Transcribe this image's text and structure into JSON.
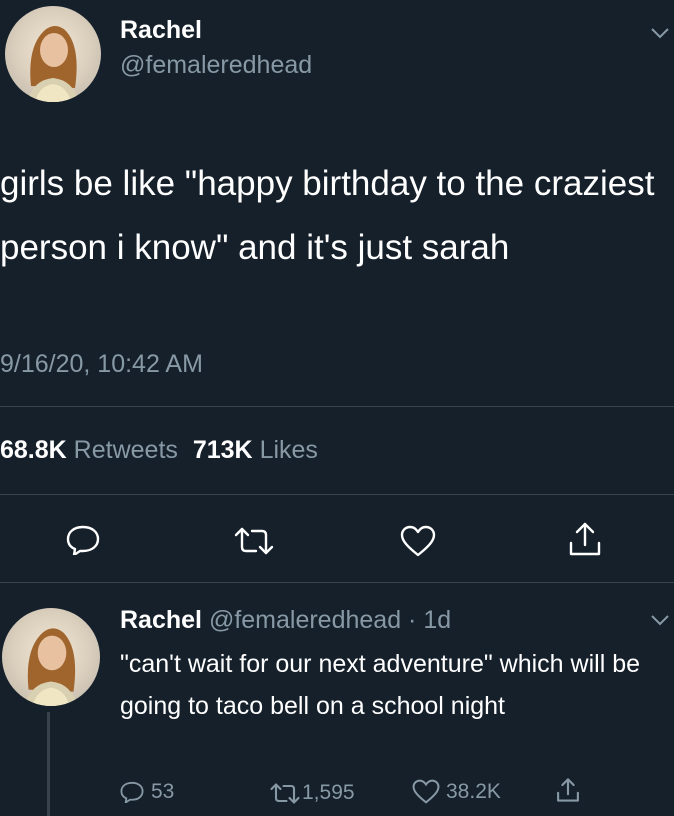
{
  "main_tweet": {
    "display_name": "Rachel",
    "handle": "@femaleredhead",
    "text": "girls be like \"happy birthday to the craziest person i know\" and it's just sarah",
    "timestamp": "9/16/20, 10:42 AM",
    "retweet_count": "68.8K",
    "retweet_label": "Retweets",
    "like_count": "713K",
    "like_label": "Likes"
  },
  "reply_tweet": {
    "display_name": "Rachel",
    "handle_time": "@femaleredhead · 1d",
    "text": "\"can't wait for our next adventure\" which will be going to taco bell on a school night",
    "reply_count": "53",
    "retweet_count": "1,595",
    "like_count": "38.2K"
  },
  "icons": [
    "reply-icon",
    "retweet-icon",
    "like-icon",
    "share-icon",
    "chevron-down-icon"
  ],
  "colors": {
    "background": "#15202b",
    "text": "#ffffff",
    "muted": "#8899a6",
    "divider": "#38444d"
  }
}
